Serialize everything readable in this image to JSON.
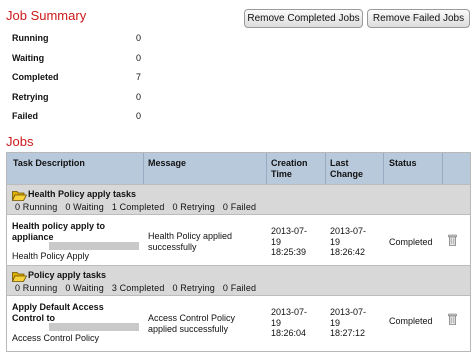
{
  "summary": {
    "title": "Job Summary",
    "rows": [
      {
        "label": "Running",
        "value": "0"
      },
      {
        "label": "Waiting",
        "value": "0"
      },
      {
        "label": "Completed",
        "value": "7"
      },
      {
        "label": "Retrying",
        "value": "0"
      },
      {
        "label": "Failed",
        "value": "0"
      }
    ]
  },
  "buttons": {
    "remove_completed": "Remove Completed Jobs",
    "remove_failed": "Remove Failed Jobs"
  },
  "jobs": {
    "title": "Jobs",
    "columns": {
      "task": "Task Description",
      "message": "Message",
      "creation_1": "Creation",
      "creation_2": "Time",
      "change_1": "Last",
      "change_2": "Change",
      "status": "Status"
    },
    "groups": [
      {
        "name": "Health Policy apply tasks",
        "stats": "0 Running   0 Waiting   1 Completed   0 Retrying   0 Failed",
        "job": {
          "title_1": "Health policy apply to",
          "title_2": "appliance",
          "subtitle": "Health Policy Apply",
          "message_1": "Health Policy applied",
          "message_2": "successfully",
          "created_1": "2013-07-",
          "created_2": "19",
          "created_3": "18:25:39",
          "changed_1": "2013-07-",
          "changed_2": "19",
          "changed_3": "18:26:42",
          "status": "Completed"
        }
      },
      {
        "name": "Policy apply tasks",
        "stats": "0 Running   0 Waiting   3 Completed   0 Retrying   0 Failed",
        "job": {
          "title_1": "Apply Default Access",
          "title_2": "Control to",
          "subtitle": "Access Control Policy",
          "message_1": "Access Control Policy",
          "message_2": "applied successfully",
          "created_1": "2013-07-",
          "created_2": "19",
          "created_3": "18:26:04",
          "changed_1": "2013-07-",
          "changed_2": "19",
          "changed_3": "18:27:12",
          "status": "Completed"
        }
      }
    ]
  },
  "icons": {
    "group": "folder-open-icon",
    "row_action": "trash-icon"
  },
  "colors": {
    "section_title": "#cc1a1a",
    "header_bg": "#b9c9dc",
    "group_bg": "#d8d8d8"
  }
}
